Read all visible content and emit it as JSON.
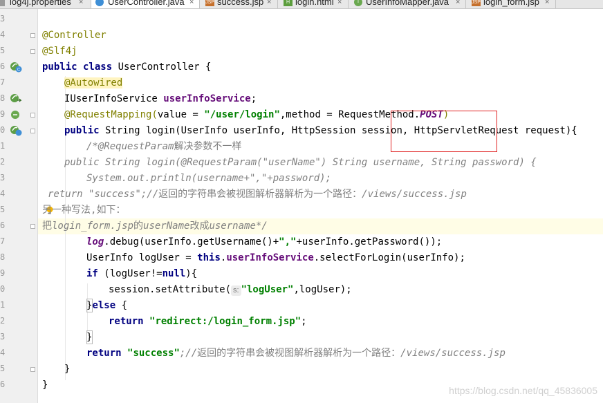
{
  "tabs": [
    {
      "label": "log4j.properties",
      "icon": "properties-file-icon",
      "active": false
    },
    {
      "label": "UserController.java",
      "icon": "java-class-icon",
      "active": true
    },
    {
      "label": "success.jsp",
      "icon": "jsp-file-icon",
      "active": false
    },
    {
      "label": "login.html",
      "icon": "html-file-icon",
      "active": false
    },
    {
      "label": "UserInfoMapper.java",
      "icon": "java-interface-icon",
      "active": false
    },
    {
      "label": "login_form.jsp",
      "icon": "jsp-file-icon",
      "active": false
    }
  ],
  "tab_close_glyph": "×",
  "line_numbers": [
    "3",
    "4",
    "5",
    "6",
    "7",
    "8",
    "9",
    "0",
    "1",
    "2",
    "3",
    "4",
    "5",
    "6",
    "7",
    "8",
    "9",
    "0",
    "1",
    "2",
    "3",
    "4",
    "5",
    "6"
  ],
  "code": {
    "l04": "@Controller",
    "l05": "@Slf4j",
    "l06_kw": "public class",
    "l06_rest": " UserController {",
    "l07": "@Autowired",
    "l08_type": "IUserInfoService ",
    "l08_field": "userInfoService",
    "l08_semi": ";",
    "l09_ann": "@RequestMapping(",
    "l09_a": "value = ",
    "l09_str": "\"/user/login\"",
    "l09_b": ",method = RequestMethod.",
    "l09_const": "POST",
    "l09_c": ")",
    "l10_kw": "public",
    "l10_rest": " String login(UserInfo userInfo, HttpSession session, HttpServletRequest request){",
    "l11_a": "/*@RequestParam",
    "l11_b": "解决参数不一样",
    "l12": "public String login(@RequestParam(\"userName\") String username, String password) {",
    "l13": "System.out.println(username+\",\"+password);",
    "l14_a": "return \"success\";//",
    "l14_b": "返回的字符串会被视图解析器解析为一个路径：",
    "l14_c": "/views/success.jsp",
    "l15_a": "另一种写法",
    "l15_b": ",",
    "l15_c": "如下：",
    "l16_a": "把",
    "l16_b": "login_form.jsp",
    "l16_c": "的",
    "l16_d": "userName",
    "l16_e": "改成",
    "l16_f": "username*/",
    "l17_log": "log",
    "l17_a": ".debug(userInfo.getUsername()+",
    "l17_str": "\",\"",
    "l17_b": "+userInfo.getPassword());",
    "l18_a": "UserInfo logUser = ",
    "l18_this": "this",
    "l18_dot": ".",
    "l18_field": "userInfoService",
    "l18_b": ".selectForLogin(userInfo);",
    "l19_kw": "if",
    "l19_a": " (logUser!=",
    "l19_null": "null",
    "l19_b": "){",
    "l20_a": "session.setAttribute(",
    "l20_hint": "s:",
    "l20_str": "\"logUser\"",
    "l20_b": ",logUser);",
    "l21_a": "}",
    "l21_kw": "else",
    "l21_b": " {",
    "l22_kw": "return ",
    "l22_str": "\"redirect:/login_form.jsp\"",
    "l22_semi": ";",
    "l23": "}",
    "l24_kw": "return ",
    "l24_str": "\"success\"",
    "l24_a": ";//",
    "l24_b": "返回的字符串会被视图解析器解析为一个路径：",
    "l24_c": "/views/success.jsp",
    "l25": "}",
    "l26": "}"
  },
  "watermark": "https://blog.csdn.net/qq_45836005",
  "colors": {
    "keyword": "#000080",
    "annotation": "#808000",
    "string": "#008000",
    "field": "#660e7a",
    "comment": "#808080",
    "highlight_box": "#e02020"
  }
}
